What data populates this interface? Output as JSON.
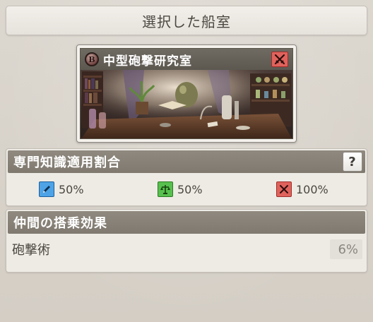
{
  "header": {
    "title": "選択した船室"
  },
  "room": {
    "badge_letter": "B",
    "name": "中型砲撃研究室",
    "type_icon": "crossed-swords-icon",
    "type_color": "#e0625c"
  },
  "specialty": {
    "title": "専門知識適用割合",
    "help_label": "?",
    "items": [
      {
        "icon": "pen-icon",
        "color": "#4ea3e6",
        "value": "50%"
      },
      {
        "icon": "scales-icon",
        "color": "#58c04e",
        "value": "50%"
      },
      {
        "icon": "crossed-swords-icon",
        "color": "#e0625c",
        "value": "100%"
      }
    ]
  },
  "crew_effect": {
    "title": "仲間の搭乗効果",
    "rows": [
      {
        "label": "砲撃術",
        "value": "6%"
      }
    ]
  }
}
